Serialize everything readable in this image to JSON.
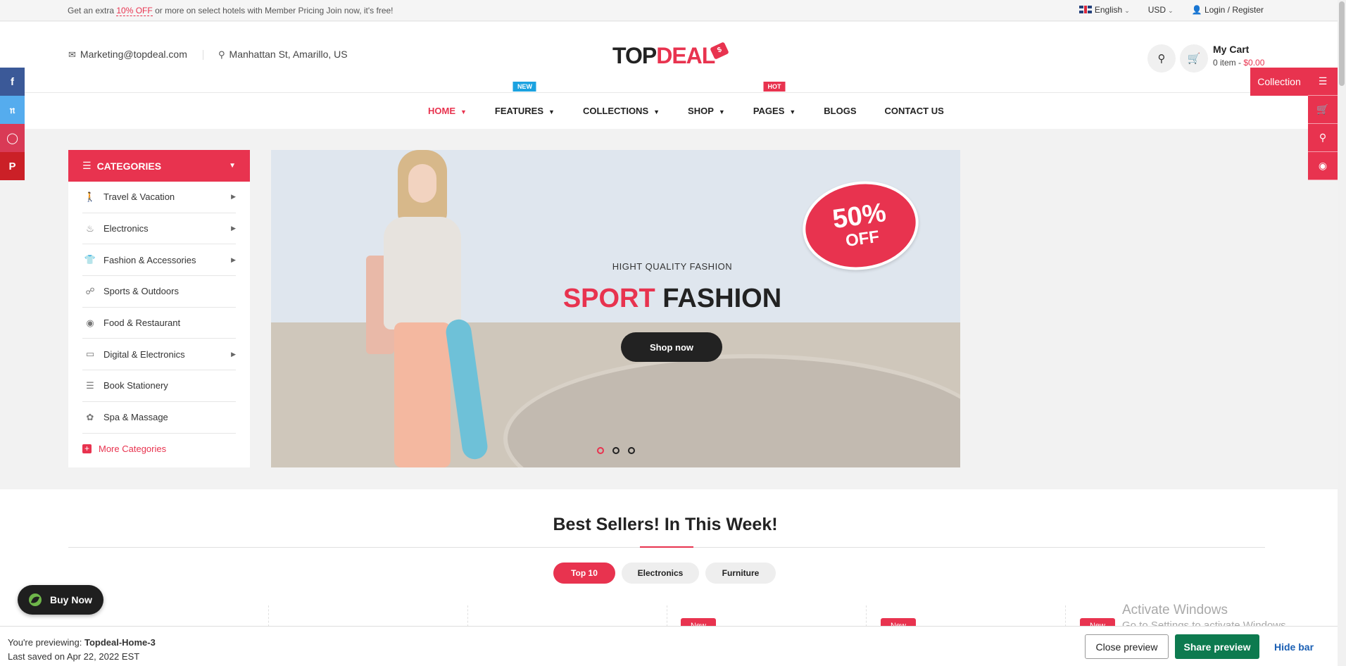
{
  "topbar": {
    "promo_prefix": "Get an extra ",
    "promo_highlight": "10% OFF",
    "promo_suffix": " or more on select hotels with Member Pricing Join now, it's free!",
    "language": "English",
    "currency": "USD",
    "login": "Login / Register"
  },
  "header": {
    "email": "Marketing@topdeal.com",
    "address": "Manhattan St, Amarillo, US",
    "logo_part1": "TOP",
    "logo_part2": "DEAL",
    "cart_title": "My Cart",
    "cart_items": "0 item - ",
    "cart_price": "$0.00"
  },
  "nav": {
    "items": [
      {
        "label": "HOME",
        "active": true
      },
      {
        "label": "FEATURES",
        "badge": "NEW"
      },
      {
        "label": "COLLECTIONS"
      },
      {
        "label": "SHOP"
      },
      {
        "label": "PAGES",
        "badge": "HOT"
      },
      {
        "label": "BLOGS"
      },
      {
        "label": "CONTACT US"
      }
    ]
  },
  "collection_tab": "Collection",
  "categories": {
    "title": "CATEGORIES",
    "items": [
      {
        "label": "Travel & Vacation",
        "icon": "walking-icon",
        "has_sub": true
      },
      {
        "label": "Electronics",
        "icon": "flame-icon",
        "has_sub": true
      },
      {
        "label": "Fashion & Accessories",
        "icon": "tshirt-icon",
        "has_sub": true
      },
      {
        "label": "Sports & Outdoors",
        "icon": "link-icon",
        "has_sub": false
      },
      {
        "label": "Food & Restaurant",
        "icon": "helmet-icon",
        "has_sub": false
      },
      {
        "label": "Digital & Electronics",
        "icon": "laptop-icon",
        "has_sub": true
      },
      {
        "label": "Book Stationery",
        "icon": "books-icon",
        "has_sub": false
      },
      {
        "label": "Spa & Massage",
        "icon": "lotus-icon",
        "has_sub": false
      }
    ],
    "more": "More Categories"
  },
  "hero": {
    "sale_pct": "50%",
    "sale_off": "OFF",
    "subtitle": "HIGHT QUALITY FASHION",
    "title_accent": "SPORT",
    "title_rest": "FASHION",
    "button": "Shop now",
    "slide_count": 3,
    "active_slide": 1
  },
  "best": {
    "heading": "Best Sellers! In This Week!",
    "tabs": [
      "Top 10",
      "Electronics",
      "Furniture"
    ],
    "new_label": "New"
  },
  "buy_now": "Buy Now",
  "watermark": {
    "line1": "Activate Windows",
    "line2": "Go to Settings to activate Windows."
  },
  "preview_bar": {
    "previewing_label": "You're previewing: ",
    "theme_name": "Topdeal-Home-3",
    "last_saved": "Last saved on Apr 22, 2022 EST",
    "close": "Close preview",
    "share": "Share preview",
    "hide": "Hide bar"
  },
  "colors": {
    "accent": "#e8334f",
    "facebook": "#3b5998",
    "twitter": "#55acee",
    "instagram": "#d93a56",
    "pinterest": "#cb2027",
    "share_green": "#0d7a4f"
  }
}
